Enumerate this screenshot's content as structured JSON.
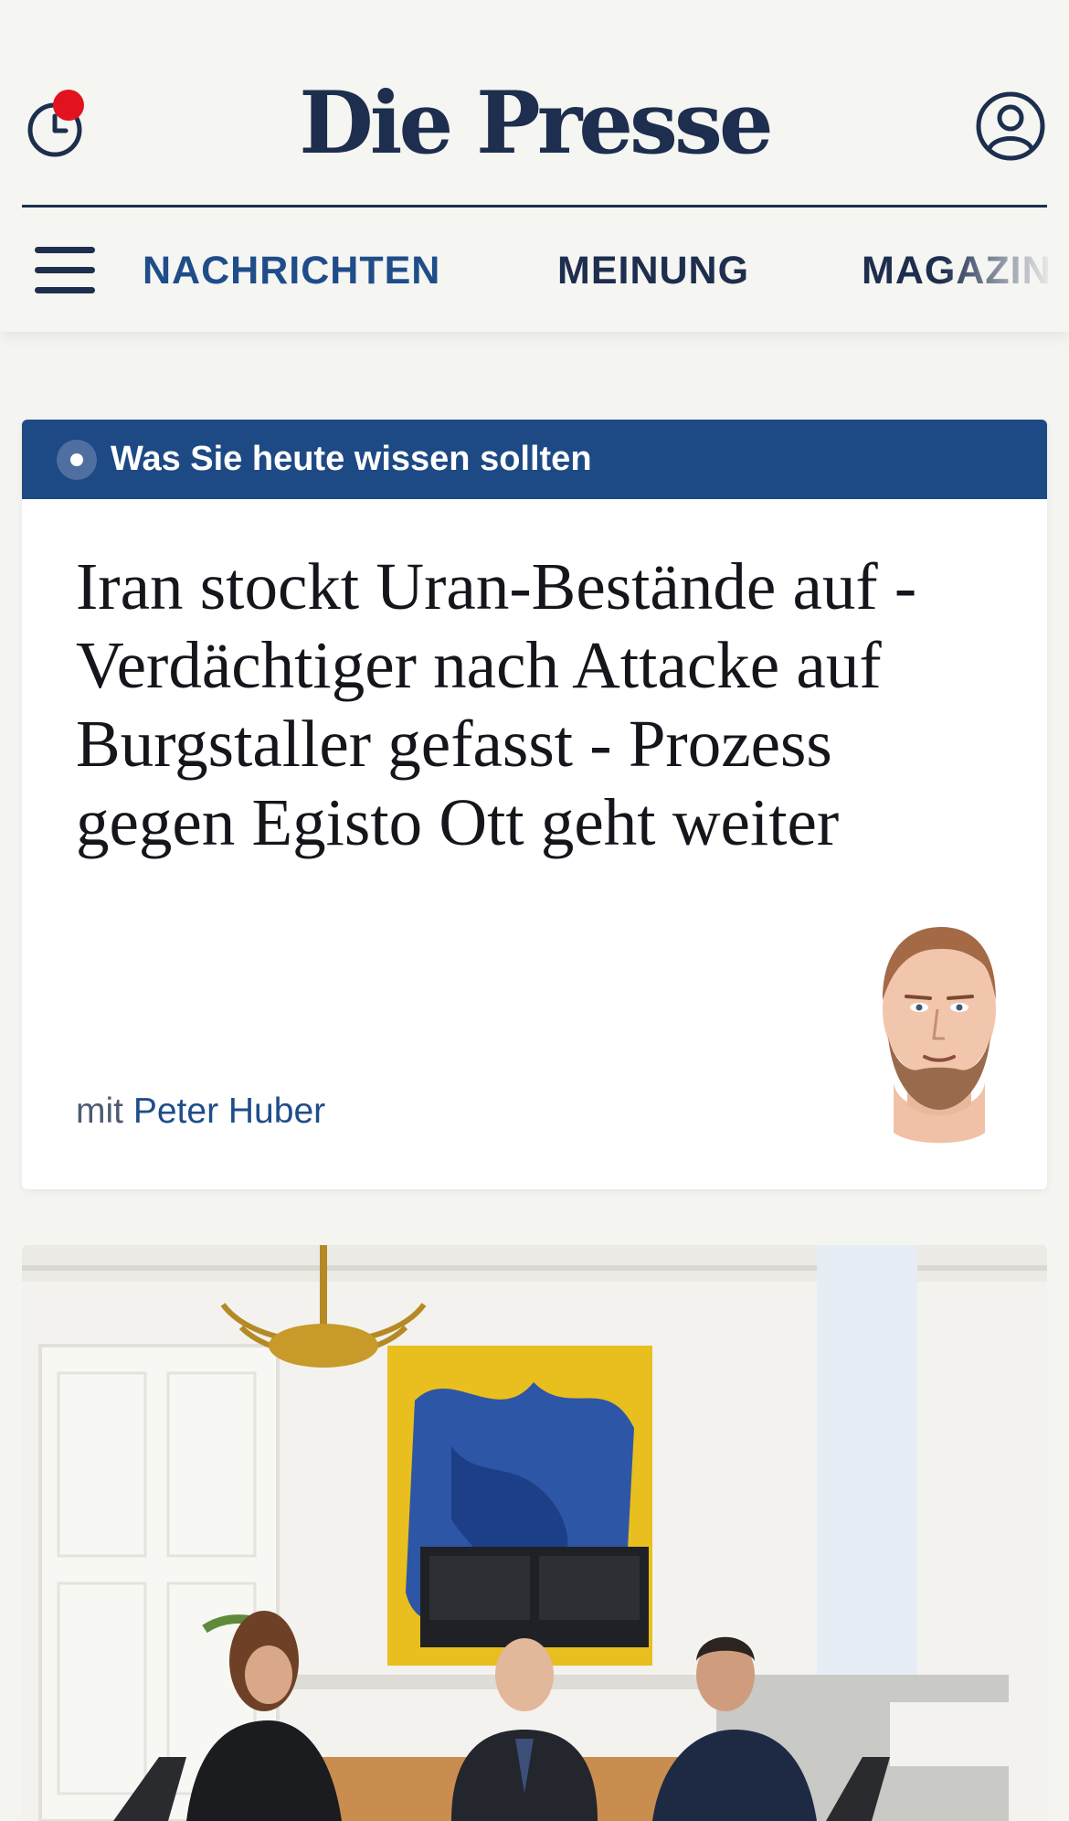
{
  "header": {
    "logo": "Die Presse",
    "icons": {
      "history": "clock-icon",
      "notification": "notification-dot",
      "account": "user-circle-icon",
      "menu": "hamburger-menu-icon"
    }
  },
  "nav": {
    "items": [
      {
        "label": "NACHRICHTEN",
        "active": true
      },
      {
        "label": "MEINUNG",
        "active": false
      },
      {
        "label": "MAGAZIN",
        "active": false
      }
    ]
  },
  "briefing": {
    "label": "Was Sie heute wissen sollten",
    "headline": "Iran stockt Uran-Bestände auf - Verdächtiger nach Attacke auf Burgstaller gefasst - Prozess gegen Egisto Ott geht weiter",
    "byline_prefix": "mit",
    "author": "Peter Huber"
  },
  "colors": {
    "brand_navy": "#1d2e4e",
    "band_blue": "#1d4a85",
    "active_nav": "#1f4d8a",
    "notification_red": "#e3121f",
    "background": "#f4f4f1"
  }
}
